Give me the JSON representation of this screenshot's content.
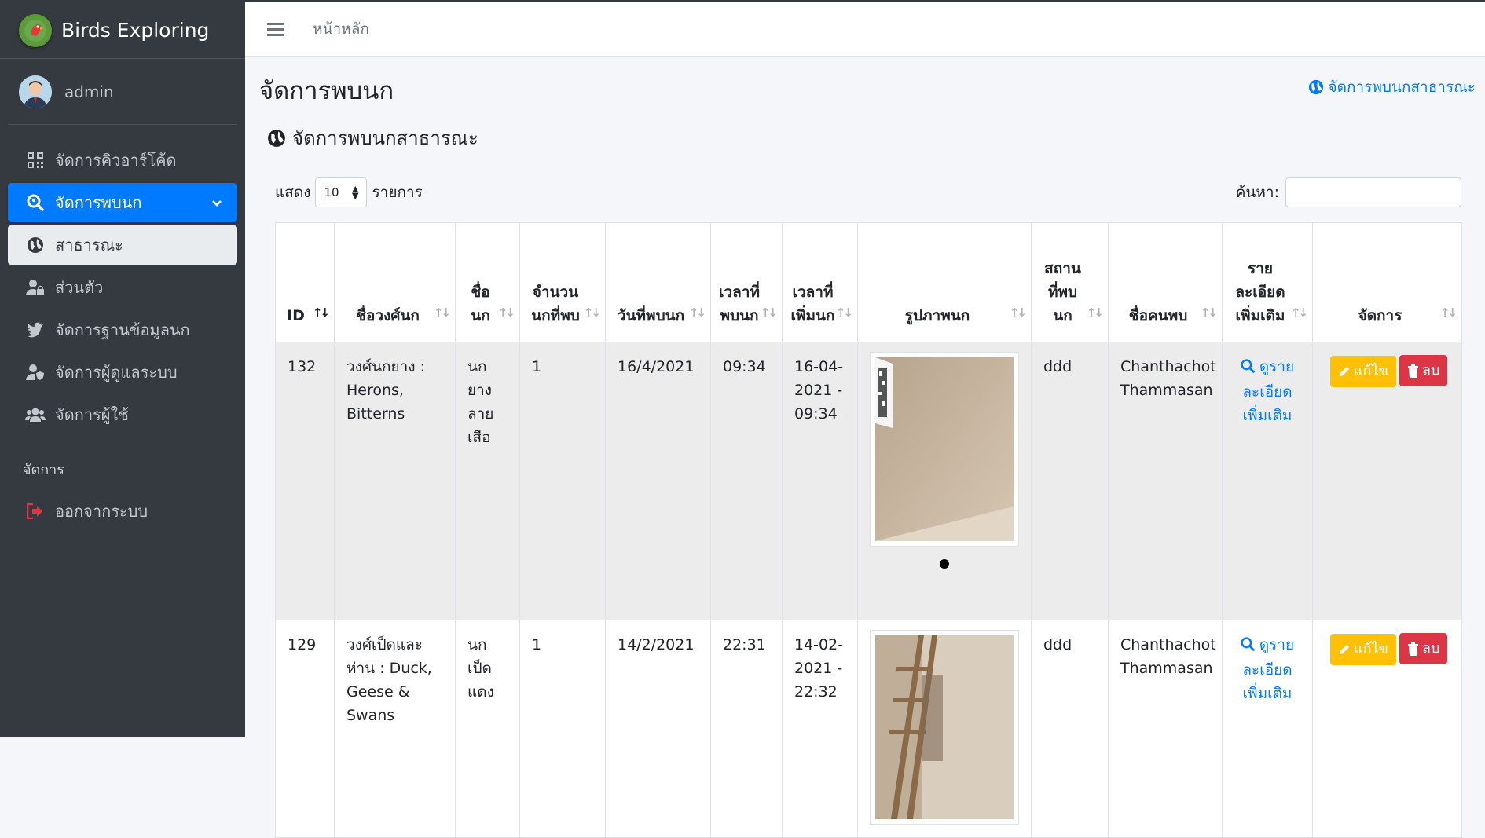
{
  "brand": {
    "name": "Birds Exploring"
  },
  "user": {
    "name": "admin"
  },
  "sidebar": {
    "items": [
      {
        "label": "จัดการคิวอาร์โค้ด",
        "icon": "qrcode-icon"
      },
      {
        "label": "จัดการพบนก",
        "icon": "search-location-icon"
      },
      {
        "label": "สาธารณะ",
        "icon": "globe-icon"
      },
      {
        "label": "ส่วนตัว",
        "icon": "user-lock-icon"
      },
      {
        "label": "จัดการฐานข้อมูลนก",
        "icon": "twitter-bird-icon"
      },
      {
        "label": "จัดการผู้ดูแลระบบ",
        "icon": "user-shield-icon"
      },
      {
        "label": "จัดการผู้ใช้",
        "icon": "users-icon"
      }
    ],
    "section_header": "จัดการ",
    "logout": {
      "label": "ออกจากระบบ",
      "icon": "sign-out-icon"
    }
  },
  "topbar": {
    "home_link": "หน้าหลัก"
  },
  "page": {
    "title": "จัดการพบนก",
    "header_link": "จัดการพบนกสาธารณะ",
    "card_title": "จัดการพบนกสาธารณะ"
  },
  "table_controls": {
    "show_label": "แสดง",
    "page_size": "10",
    "entries_label": "รายการ",
    "search_label": "ค้นหา:"
  },
  "table": {
    "columns": [
      "ID",
      "ชื่อวงศ์นก",
      "ชื่อนก",
      "จำนวนนกที่พบ",
      "วันที่พบนก",
      "เวลาที่พบนก",
      "เวลาที่เพิ่มนก",
      "รูปภาพนก",
      "สถานที่พบนก",
      "ชื่อคนพบ",
      "รายละเอียดเพิ่มเติม",
      "จัดการ"
    ],
    "rows": [
      {
        "id": "132",
        "family": "วงศ์นกยาง : Herons, Bitterns",
        "bird": "นกยางลายเสือ",
        "count": "1",
        "date": "16/4/2021",
        "time": "09:34",
        "added": "16-04-2021 - 09:34",
        "place": "ddd",
        "finder": "Chanthachot Thammasan",
        "detail": "ดูรายละเอียดเพิ่มเติม",
        "edit": "แก้ไข",
        "delete": "ลบ"
      },
      {
        "id": "129",
        "family": "วงศ์เป็ดและห่าน : Duck, Geese & Swans",
        "bird": "นกเป็ดแดง",
        "count": "1",
        "date": "14/2/2021",
        "time": "22:31",
        "added": "14-02-2021 - 22:32",
        "place": "ddd",
        "finder": "Chanthachot Thammasan",
        "detail": "ดูรายละเอียดเพิ่มเติม",
        "edit": "แก้ไข",
        "delete": "ลบ"
      }
    ]
  },
  "colors": {
    "primary": "#007bff",
    "warning": "#ffc107",
    "danger": "#dc3545",
    "sidebar": "#343a40"
  }
}
